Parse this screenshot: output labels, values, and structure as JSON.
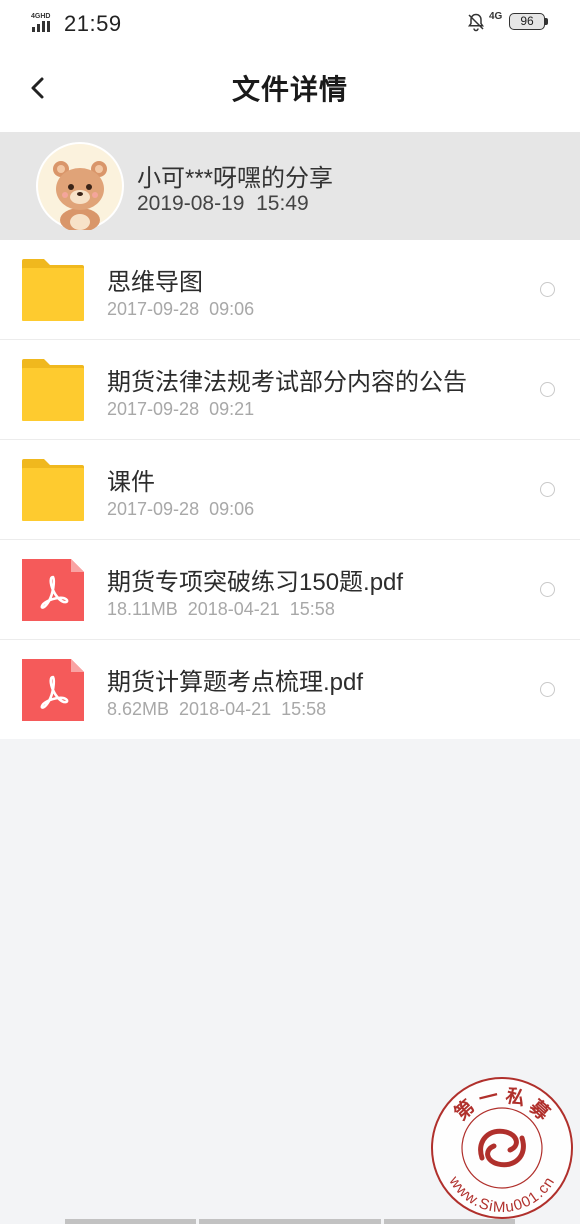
{
  "status_bar": {
    "network_label": "4GHD",
    "time": "21:59",
    "network_right": "4G",
    "battery": "96",
    "icons": [
      "signal-icon",
      "bell-muted-icon",
      "battery-icon"
    ]
  },
  "header": {
    "title": "文件详情",
    "back_icon": "chevron-left-icon"
  },
  "share": {
    "name": "小可***呀嘿的分享",
    "time": "2019-08-19  15:49",
    "avatar_icon": "bear-avatar"
  },
  "files": [
    {
      "name": "思维导图",
      "meta": "2017-09-28  09:06",
      "type": "folder"
    },
    {
      "name": "期货法律法规考试部分内容的公告",
      "meta": "2017-09-28  09:21",
      "type": "folder"
    },
    {
      "name": "课件",
      "meta": "2017-09-28  09:06",
      "type": "folder"
    },
    {
      "name": "期货专项突破练习150题.pdf",
      "meta": "18.11MB  2018-04-21  15:58",
      "type": "pdf"
    },
    {
      "name": "期货计算题考点梳理.pdf",
      "meta": "8.62MB  2018-04-21  15:58",
      "type": "pdf"
    }
  ],
  "watermark": {
    "top_text": "第 一 私 募",
    "bottom_text": "www.SiMu001.cn"
  },
  "colors": {
    "folder": "#fecb2f",
    "pdf": "#f55a5a",
    "banner_bg": "#e6e6e6",
    "page_bg": "#f3f4f6",
    "watermark": "#b0302c"
  }
}
